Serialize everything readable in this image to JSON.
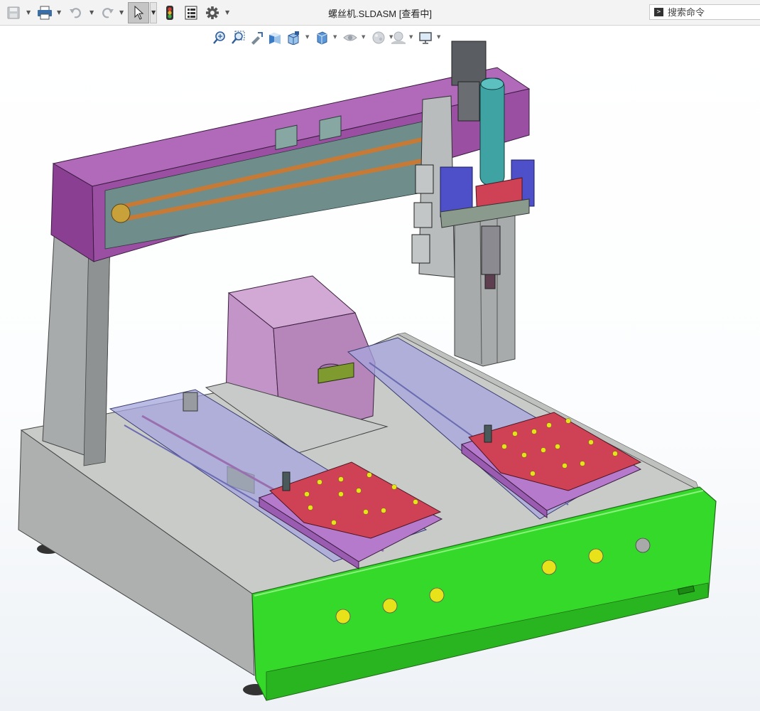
{
  "window": {
    "title": "螺丝机.SLDASM [查看中]"
  },
  "toolbar": {
    "items": [
      {
        "name": "save-icon"
      },
      {
        "name": "print-icon"
      },
      {
        "name": "undo-icon"
      },
      {
        "name": "redo-icon"
      },
      {
        "name": "select-arrow-icon"
      },
      {
        "name": "rebuild-traffic-light-icon"
      },
      {
        "name": "file-properties-icon"
      },
      {
        "name": "options-gear-icon"
      }
    ]
  },
  "search": {
    "placeholder": "搜索命令"
  },
  "view_toolbar": {
    "items": [
      {
        "name": "zoom-to-fit-icon"
      },
      {
        "name": "zoom-to-area-icon"
      },
      {
        "name": "previous-view-icon"
      },
      {
        "name": "section-view-icon"
      },
      {
        "name": "view-orientation-icon"
      },
      {
        "name": "display-style-icon"
      },
      {
        "name": "hide-show-items-icon"
      },
      {
        "name": "edit-appearance-icon"
      },
      {
        "name": "apply-scene-icon"
      },
      {
        "name": "view-settings-icon"
      }
    ]
  },
  "colors": {
    "base_body": "#c9cbc9",
    "base_front": "#35d92a",
    "gantry_beam": "#9a4fa3",
    "column": "#a7abab",
    "fixture_plate": "#cf4255",
    "cover_box": "#c394c8",
    "screwdriver": "#3fa3a3",
    "holes": "#e8e21a",
    "glass_rails": "#a5a6dd"
  }
}
